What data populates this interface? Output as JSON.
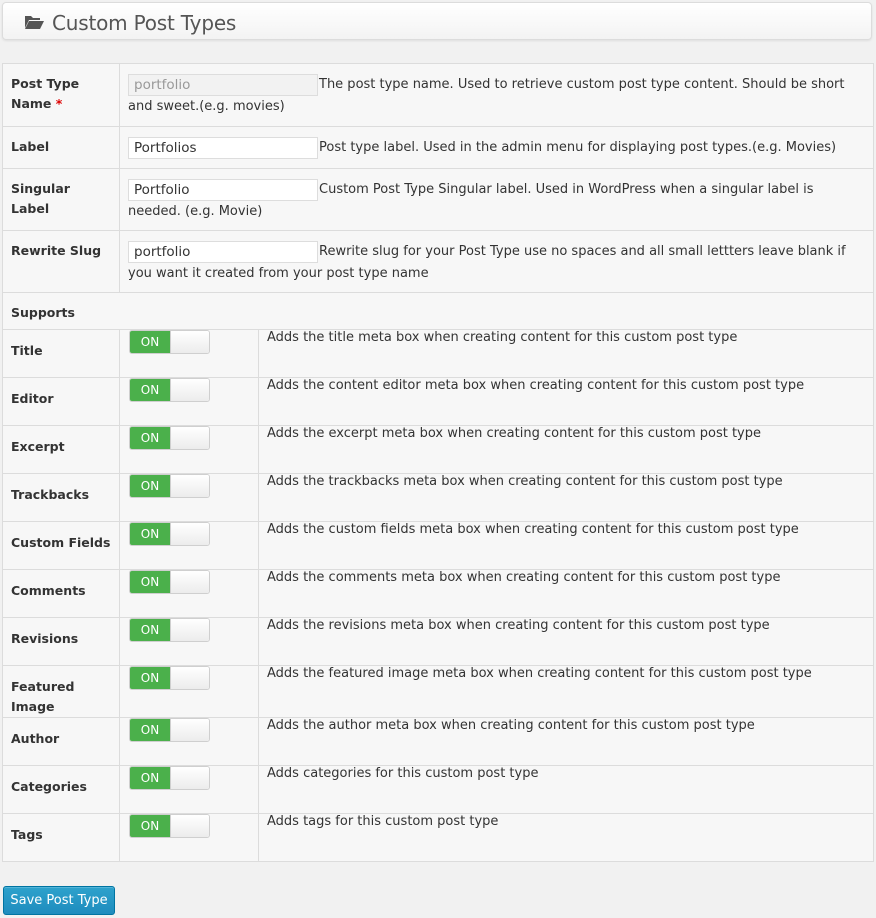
{
  "header": {
    "title": "Custom Post Types",
    "icon": "folder-open-icon"
  },
  "fields": [
    {
      "label": "Post Type Name",
      "required_mark": "*",
      "value": "portfolio",
      "readonly": true,
      "description": "The post type name. Used to retrieve custom post type content. Should be short and sweet.(e.g. movies)"
    },
    {
      "label": "Label",
      "value": "Portfolios",
      "readonly": false,
      "description": "Post type label. Used in the admin menu for displaying post types.(e.g. Movies)"
    },
    {
      "label": "Singular Label",
      "value": "Portfolio",
      "readonly": false,
      "description": "Custom Post Type Singular label. Used in WordPress when a singular label is needed. (e.g. Movie)"
    },
    {
      "label": "Rewrite Slug",
      "value": "portfolio",
      "readonly": false,
      "description": "Rewrite slug for your Post Type use no spaces and all small lettters leave blank if you want it created from your post type name"
    }
  ],
  "supports": {
    "heading": "Supports",
    "items": [
      {
        "label": "Title",
        "state": "ON",
        "description": "Adds the title meta box when creating content for this custom post type"
      },
      {
        "label": "Editor",
        "state": "ON",
        "description": "Adds the content editor meta box when creating content for this custom post type"
      },
      {
        "label": "Excerpt",
        "state": "ON",
        "description": "Adds the excerpt meta box when creating content for this custom post type"
      },
      {
        "label": "Trackbacks",
        "state": "ON",
        "description": "Adds the trackbacks meta box when creating content for this custom post type"
      },
      {
        "label": "Custom Fields",
        "state": "ON",
        "description": "Adds the custom fields meta box when creating content for this custom post type"
      },
      {
        "label": "Comments",
        "state": "ON",
        "description": "Adds the comments meta box when creating content for this custom post type"
      },
      {
        "label": "Revisions",
        "state": "ON",
        "description": "Adds the revisions meta box when creating content for this custom post type"
      },
      {
        "label": "Featured Image",
        "state": "ON",
        "description": "Adds the featured image meta box when creating content for this custom post type"
      },
      {
        "label": "Author",
        "state": "ON",
        "description": "Adds the author meta box when creating content for this custom post type"
      },
      {
        "label": "Categories",
        "state": "ON",
        "description": "Adds categories for this custom post type"
      },
      {
        "label": "Tags",
        "state": "ON",
        "description": "Adds tags for this custom post type"
      }
    ]
  },
  "colors": {
    "toggle_on": "#4bb04b",
    "save_button": "#2ea2cc",
    "required": "#dd0000"
  },
  "save_button": {
    "label": "Save Post Type"
  }
}
